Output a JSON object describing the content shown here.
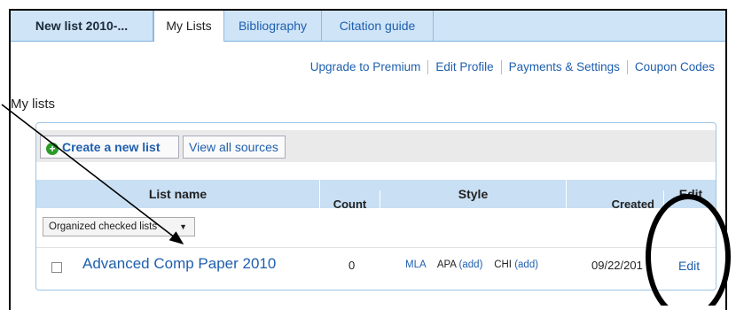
{
  "tabs": [
    {
      "label": "New list 2010-..."
    },
    {
      "label": "My Lists"
    },
    {
      "label": "Bibliography"
    },
    {
      "label": "Citation guide"
    }
  ],
  "top_links": [
    "Upgrade to Premium",
    "Edit Profile",
    "Payments & Settings",
    "Coupon Codes"
  ],
  "heading": "My lists",
  "toolbar": {
    "create_label": "Create a new list",
    "view_label": "View all sources"
  },
  "table": {
    "headers": {
      "name": "List name",
      "count": "Count",
      "style": "Style",
      "created": "Created",
      "edit": "Edit"
    },
    "filter_label": "Organized checked lists",
    "rows": [
      {
        "name": "Advanced Comp Paper 2010",
        "count": "0",
        "styles": {
          "mla": "MLA",
          "apa": "APA",
          "apa_add": "(add)",
          "chi": "CHI",
          "chi_add": "(add)"
        },
        "created": "09/22/201",
        "edit": "Edit"
      }
    ]
  },
  "colors": {
    "link": "#1f5fae",
    "tabbar": "#cfe4f7",
    "header": "#c9dff3"
  }
}
